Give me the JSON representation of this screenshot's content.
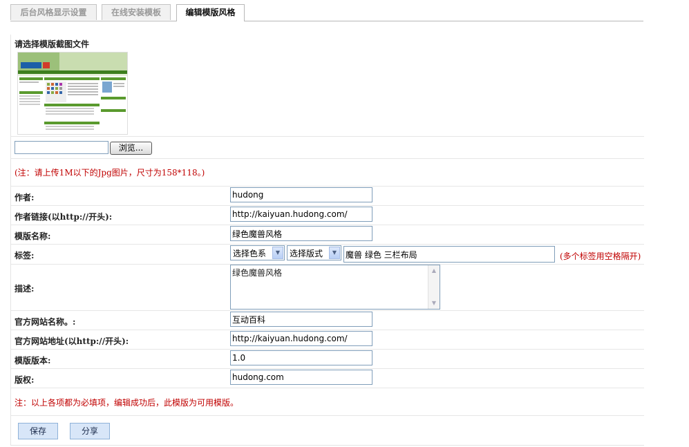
{
  "tabs": [
    {
      "label": "后台风格显示设置",
      "active": false
    },
    {
      "label": "在线安装模板",
      "active": false
    },
    {
      "label": "编辑模版风格",
      "active": true
    }
  ],
  "screenshot_section": {
    "title": "请选择模版截图文件",
    "file_value": "",
    "browse_label": "浏览...",
    "upload_note": "(注：请上传1M以下的Jpg图片，尺寸为158*118。)"
  },
  "fields": {
    "author": {
      "label": "作者:",
      "value": "hudong"
    },
    "author_link": {
      "label": "作者链接(以http://开头):",
      "value": "http://kaiyuan.hudong.com/"
    },
    "template_name": {
      "label": "模版名称:",
      "value": "绿色魔兽风格"
    },
    "tags": {
      "label": "标签:",
      "color_select": "选择色系",
      "layout_select": "选择版式",
      "value": "魔兽 绿色 三栏布局",
      "hint": "(多个标签用空格隔开)"
    },
    "description": {
      "label": "描述:",
      "value": "绿色魔兽风格"
    },
    "site_name": {
      "label": "官方网站名称。:",
      "value": "互动百科"
    },
    "site_url": {
      "label": "官方网站地址(以http://开头):",
      "value": "http://kaiyuan.hudong.com/"
    },
    "version": {
      "label": "模版版本:",
      "value": "1.0"
    },
    "copyright": {
      "label": "版权:",
      "value": "hudong.com"
    }
  },
  "footer_note": "注：以上各项都为必填项，编辑成功后，此模版为可用模版。",
  "buttons": {
    "save": "保存",
    "share": "分享"
  },
  "colors": {
    "accent_green": "#5a9a2e",
    "note_red": "#c00000",
    "button_bg": "#d8e6f8"
  }
}
